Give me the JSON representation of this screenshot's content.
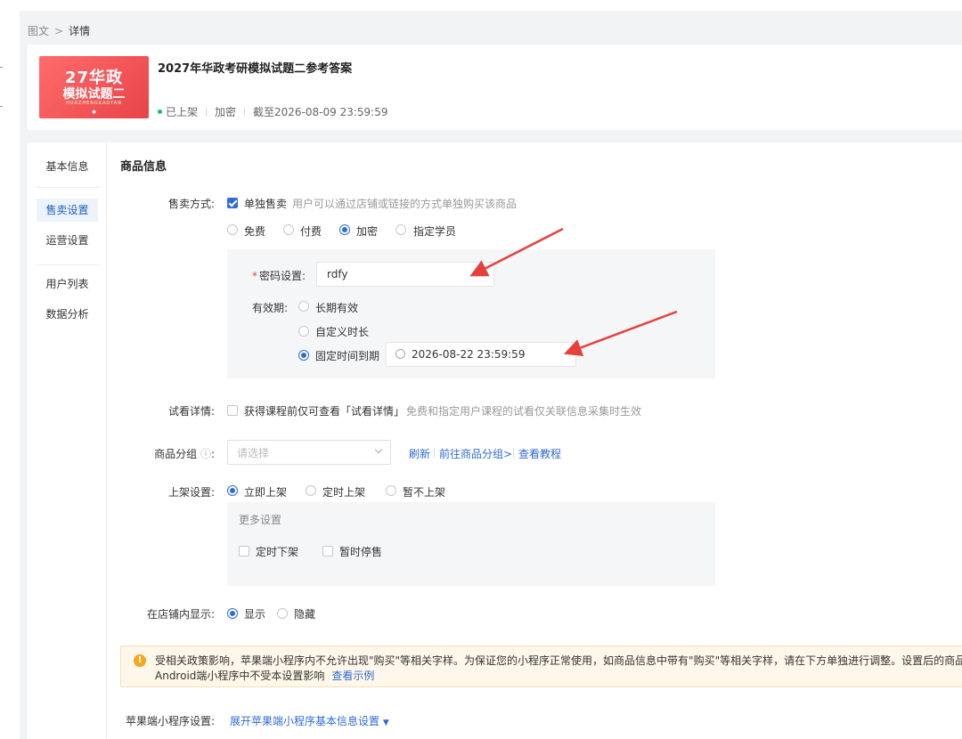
{
  "breadcrumb": {
    "parent": "图文",
    "current": "详情"
  },
  "header": {
    "title": "2027年华政考研模拟试题二参考答案",
    "cover": {
      "line1": "27华政",
      "line2": "模拟试题二",
      "line3": "HUAZHENGKAOYAN"
    },
    "status": "已上架",
    "tag": "加密",
    "deadline": "截至2026-08-09 23:59:59",
    "status_color": "#19be6b"
  },
  "sidenav": {
    "items": [
      {
        "label": "基本信息",
        "active": false
      },
      {
        "label": "售卖设置",
        "active": true
      },
      {
        "label": "运营设置",
        "active": false
      },
      {
        "label": "用户列表",
        "active": false
      },
      {
        "label": "数据分析",
        "active": false
      }
    ]
  },
  "section_title": "商品信息",
  "sale": {
    "label": "售卖方式:",
    "single_checkbox_label": "单独售卖",
    "single_checked": true,
    "single_hint": "用户可以通过店铺或链接的方式单独购买该商品",
    "options": [
      "免费",
      "付费",
      "加密",
      "指定学员"
    ],
    "selected": "加密"
  },
  "password": {
    "label": "密码设置:",
    "value": "rdfy"
  },
  "validity": {
    "label": "有效期:",
    "options": [
      "长期有效",
      "自定义时长",
      "固定时间到期"
    ],
    "selected": "固定时间到期",
    "datetime": "2026-08-22 23:59:59"
  },
  "trial": {
    "label": "试看详情:",
    "checkbox_label": "获得课程前仅可查看「试看详情」",
    "checked": false,
    "hint": "免费和指定用户课程的试看仅关联信息采集时生效"
  },
  "group": {
    "label": "商品分组",
    "placeholder": "请选择",
    "links": [
      "刷新",
      "前往商品分组>",
      "查看教程"
    ]
  },
  "shelf": {
    "label": "上架设置:",
    "options": [
      "立即上架",
      "定时上架",
      "暂不上架"
    ],
    "selected": "立即上架",
    "more_title": "更多设置",
    "more_options": [
      "定时下架",
      "暂时停售"
    ]
  },
  "display": {
    "label": "在店铺内显示:",
    "options": [
      "显示",
      "隐藏"
    ],
    "selected": "显示"
  },
  "notice": {
    "line1": "受相关政策影响，苹果端小程序内不允许出现\"购买\"等相关字样。为保证您的小程序正常使用，如商品信息中带有\"购买\"等相关字样，请在下方单独进行调整。设置后的商品信",
    "line2": "Android端小程序中不受本设置影响",
    "link": "查看示例"
  },
  "apple": {
    "label": "苹果端小程序设置:",
    "link": "展开苹果端小程序基本信息设置"
  },
  "colors": {
    "accent": "#2f6bd6",
    "annotation": "#e5413c"
  }
}
